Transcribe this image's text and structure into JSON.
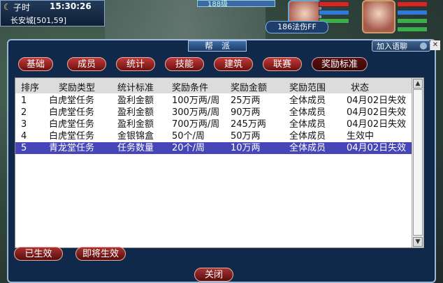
{
  "hud": {
    "period": "子时",
    "time": "15:30:26",
    "location": "长安城[501,59]",
    "top_label": "188级",
    "player_level_label": "186法伤FF"
  },
  "dialog": {
    "title": "帮派",
    "chat_button": "加入语聊",
    "tabs": [
      "基础",
      "成员",
      "统计",
      "技能",
      "建筑",
      "联赛",
      "奖励标准"
    ],
    "active_tab": "奖励标准",
    "columns": [
      "排序",
      "奖励类型",
      "统计标准",
      "奖励条件",
      "奖励金额",
      "奖励范围",
      "状态"
    ],
    "rows": [
      {
        "rank": "1",
        "type": "白虎堂任务",
        "standard": "盈利金额",
        "condition": "100万两/周",
        "amount": "25万两",
        "scope": "全体成员",
        "status": "04月02日失效"
      },
      {
        "rank": "2",
        "type": "白虎堂任务",
        "standard": "盈利金额",
        "condition": "300万两/周",
        "amount": "90万两",
        "scope": "全体成员",
        "status": "04月02日失效"
      },
      {
        "rank": "3",
        "type": "白虎堂任务",
        "standard": "盈利金额",
        "condition": "700万两/周",
        "amount": "245万两",
        "scope": "全体成员",
        "status": "04月02日失效"
      },
      {
        "rank": "4",
        "type": "白虎堂任务",
        "standard": "金银锦盒",
        "condition": "50个/周",
        "amount": "50万两",
        "scope": "全体成员",
        "status": "生效中"
      },
      {
        "rank": "5",
        "type": "青龙堂任务",
        "standard": "任务数量",
        "condition": "20个/周",
        "amount": "10万两",
        "scope": "全体成员",
        "status": "04月02日失效"
      }
    ],
    "selected_row": 4,
    "filter_buttons": [
      "已生效",
      "即将生效"
    ],
    "close_button": "关闭"
  },
  "colors": {
    "dialog_bg": "#10284a",
    "tab_red": "#c03a3a",
    "selected_row": "#4646b8"
  }
}
